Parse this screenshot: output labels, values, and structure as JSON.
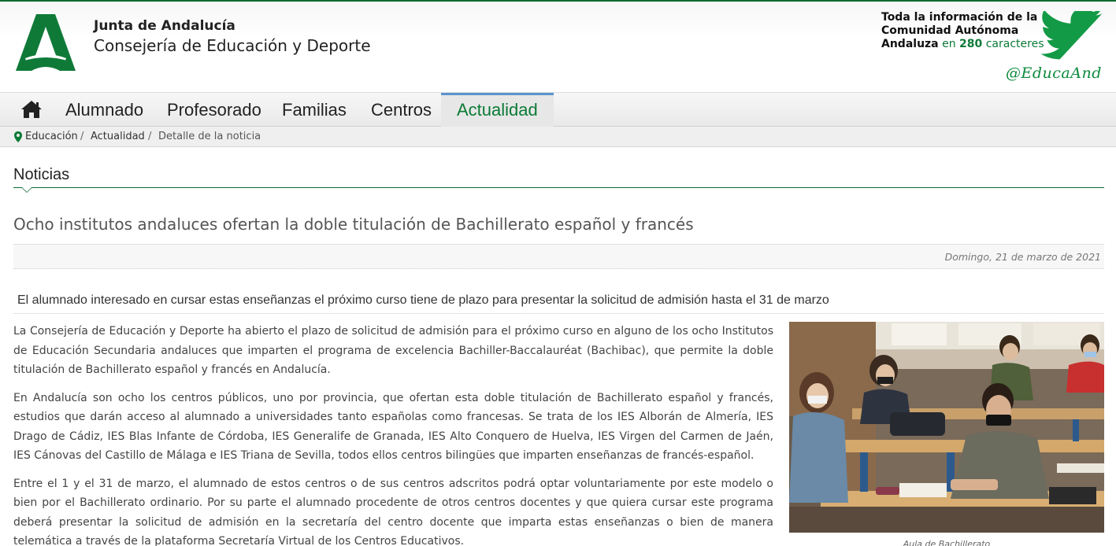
{
  "header": {
    "org_name": "Junta de Andalucía",
    "org_department": "Consejería de Educación y Deporte",
    "twitter_line1": "Toda la información de la",
    "twitter_line2": "Comunidad Autónoma",
    "twitter_line3_a": "Andaluza",
    "twitter_line3_b": "en",
    "twitter_line3_c": "280",
    "twitter_line3_d": "caracteres",
    "twitter_handle": "@EducaAnd",
    "logo_icon": "junta-andalucia-logo-icon",
    "twitter_icon": "twitter-bird-icon"
  },
  "nav": {
    "home_icon": "home-icon",
    "items": [
      {
        "label": "Alumnado"
      },
      {
        "label": "Profesorado"
      },
      {
        "label": "Familias"
      },
      {
        "label": "Centros"
      },
      {
        "label": "Actualidad",
        "active": true
      }
    ]
  },
  "breadcrumb": {
    "items": [
      "Educación",
      "Actualidad",
      "Detalle de la noticia"
    ],
    "separator": "/"
  },
  "section": {
    "title": "Noticias"
  },
  "article": {
    "headline": "Ocho institutos andaluces ofertan la doble titulación de Bachillerato español y francés",
    "date": "Domingo, 21 de marzo de 2021",
    "subheadline": "El alumnado interesado en cursar estas enseñanzas el próximo curso tiene de plazo para presentar la solicitud de admisión hasta el 31 de marzo",
    "paragraphs": [
      "La Consejería de Educación y Deporte ha abierto el plazo de solicitud de admisión para el próximo curso en alguno de los ocho Institutos de Educación Secundaria andaluces que imparten el programa de excelencia Bachiller-Baccalauréat (Bachibac), que permite la doble titulación de Bachillerato español y francés en Andalucía.",
      "En Andalucía son ocho los centros públicos, uno por provincia, que ofertan esta doble titulación de Bachillerato español y francés, estudios que darán acceso al alumnado a universidades tanto españolas como francesas. Se trata de los IES Alborán de Almería, IES Drago de Cádiz, IES Blas Infante de Córdoba, IES Generalife de Granada, IES Alto Conquero de Huelva, IES Virgen del Carmen de Jaén, IES Cánovas del Castillo de Málaga e IES Triana de Sevilla, todos ellos centros bilingües que imparten enseñanzas de francés-español.",
      "Entre el 1 y el 31 de marzo, el alumnado de estos centros o de sus centros adscritos podrá optar voluntariamente por este modelo o bien por el Bachillerato ordinario. Por su parte el alumnado procedente de otros centros docentes y que quiera cursar este programa deberá presentar la solicitud de admisión en la secretaría del centro docente que imparta estas enseñanzas o bien de manera telemática a través de la plataforma Secretaría Virtual de los Centros Educativos."
    ],
    "photo_caption": "Aula de Bachillerato"
  },
  "colors": {
    "brand_green": "#0b7a36",
    "nav_active_border": "#5b94cf"
  }
}
